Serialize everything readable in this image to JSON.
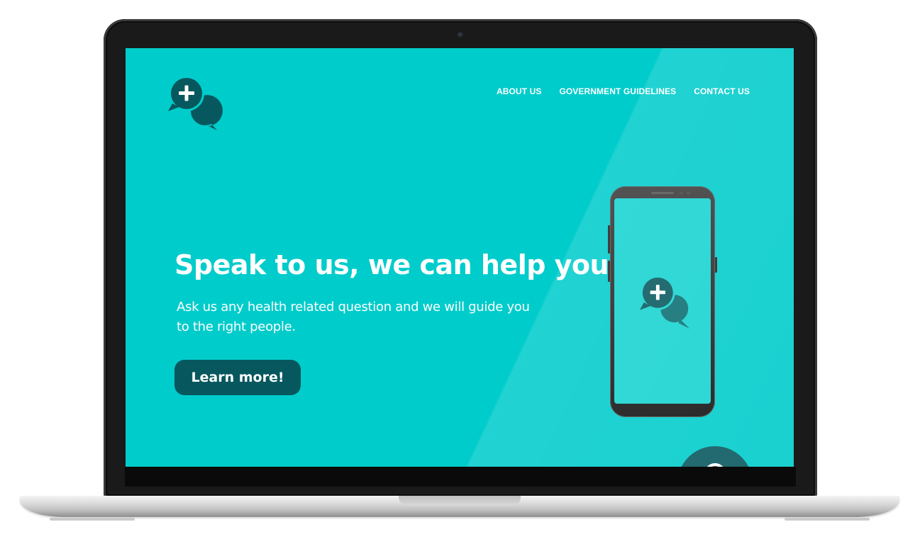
{
  "device": {
    "type": "laptop",
    "screen_bg_color": "#00cccb",
    "accent_color": "#07585e",
    "text_color": "#ffffff"
  },
  "site": {
    "logo_icon": "chat-plus-icon",
    "nav": {
      "about": "ABOUT US",
      "guidelines": "GOVERNMENT GUIDELINES",
      "contact": "CONTACT US"
    },
    "hero": {
      "headline": "Speak to us, we can help you",
      "subtext": "Ask us any health related question and we will guide you to the right people.",
      "cta_label": "Learn more!"
    },
    "phone": {
      "screen_color": "#15d3d0",
      "logo_icon": "chat-plus-icon"
    },
    "floating_button_icon": "chat-icon"
  }
}
